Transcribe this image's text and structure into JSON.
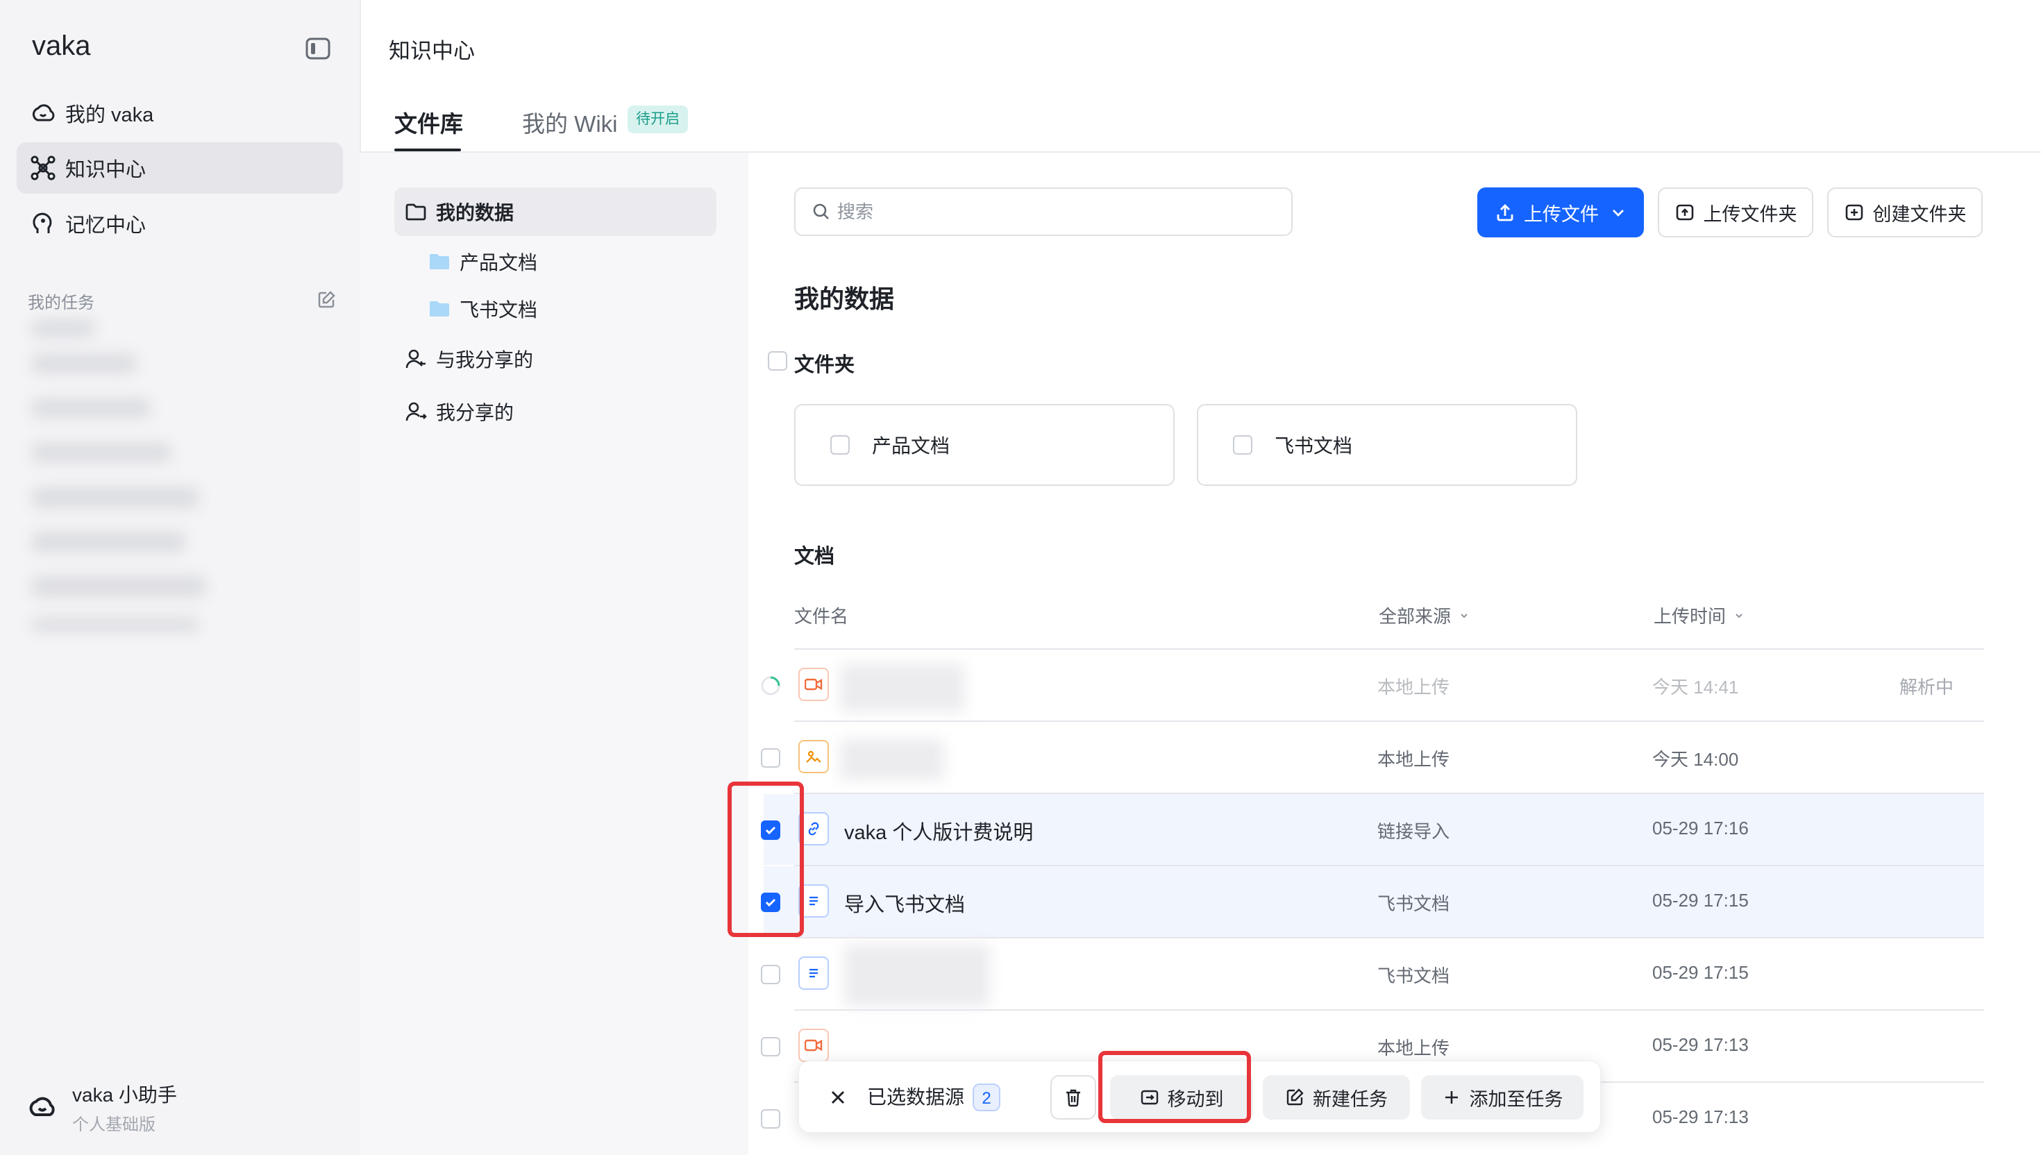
{
  "app": {
    "name": "vaka"
  },
  "sidebar": {
    "items": [
      {
        "label": "我的 vaka",
        "icon": "cloud-chat-icon"
      },
      {
        "label": "知识中心",
        "icon": "knowledge-icon",
        "active": true
      },
      {
        "label": "记忆中心",
        "icon": "memory-icon"
      }
    ],
    "tasks_label": "我的任务",
    "user": {
      "name": "vaka 小助手",
      "plan": "个人基础版"
    }
  },
  "header": {
    "title": "知识中心",
    "tabs": [
      {
        "label": "文件库",
        "active": true
      },
      {
        "label": "我的 Wiki",
        "badge": "待开启"
      }
    ]
  },
  "tree": {
    "items": [
      {
        "label": "我的数据",
        "icon": "folder-icon",
        "active": true
      },
      {
        "label": "产品文档",
        "icon": "folder-filled-icon",
        "sub": true
      },
      {
        "label": "飞书文档",
        "icon": "folder-filled-icon",
        "sub": true
      },
      {
        "label": "与我分享的",
        "icon": "user-share-in-icon"
      },
      {
        "label": "我分享的",
        "icon": "user-share-out-icon"
      }
    ]
  },
  "toolbar": {
    "search_placeholder": "搜索",
    "upload_file": "上传文件",
    "upload_folder": "上传文件夹",
    "create_folder": "创建文件夹"
  },
  "main": {
    "title": "我的数据",
    "folders_label": "文件夹",
    "folders": [
      "产品文档",
      "飞书文档"
    ],
    "docs_label": "文档",
    "columns": {
      "name": "文件名",
      "source": "全部来源",
      "time": "上传时间"
    },
    "rows": [
      {
        "name": "",
        "source": "本地上传",
        "time": "今天 14:41",
        "status": "解析中",
        "type": "video",
        "checked": false
      },
      {
        "name": "",
        "source": "本地上传",
        "time": "今天 14:00",
        "status": "",
        "type": "image",
        "checked": false
      },
      {
        "name": "vaka 个人版计费说明",
        "source": "链接导入",
        "time": "05-29 17:16",
        "status": "",
        "type": "link",
        "checked": true
      },
      {
        "name": "导入飞书文档",
        "source": "飞书文档",
        "time": "05-29 17:15",
        "status": "",
        "type": "doc",
        "checked": true
      },
      {
        "name": "",
        "source": "飞书文档",
        "time": "05-29 17:15",
        "status": "",
        "type": "doc",
        "checked": false
      },
      {
        "name": "",
        "source": "本地上传",
        "time": "05-29 17:13",
        "status": "",
        "type": "video",
        "checked": false
      },
      {
        "name": "",
        "source": "",
        "time": "05-29 17:13",
        "status": "",
        "type": "doc",
        "checked": false
      }
    ]
  },
  "actionbar": {
    "selected_label": "已选数据源",
    "selected_count": "2",
    "move_to": "移动到",
    "new_task": "新建任务",
    "add_to_task": "添加至任务"
  },
  "colors": {
    "primary": "#1664ff",
    "highlight": "#e8353a",
    "selected_row": "#f1f5fd"
  }
}
